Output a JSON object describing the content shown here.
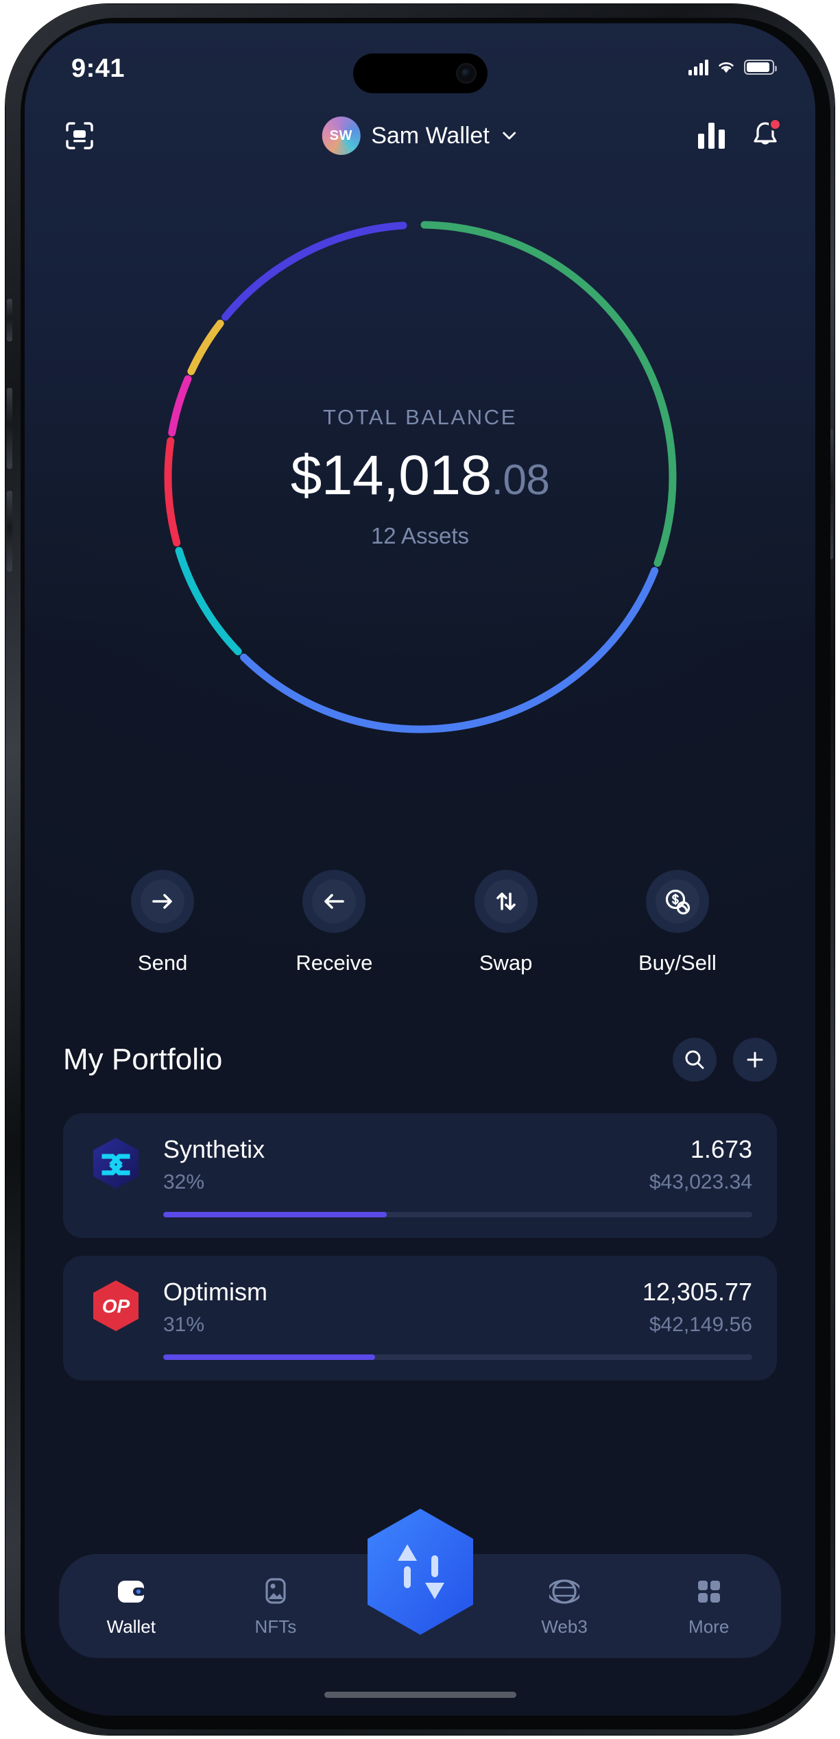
{
  "statusbar": {
    "time": "9:41",
    "signal_icon": "cellular-signal-icon",
    "wifi_icon": "wifi-icon",
    "battery_icon": "battery-icon"
  },
  "header": {
    "scan_icon": "scan-qr-icon",
    "avatar_initials": "SW",
    "wallet_name": "Sam Wallet",
    "chevron_icon": "chevron-down-icon",
    "chart_icon": "bar-chart-icon",
    "bell_icon": "bell-icon",
    "notification_badge": ""
  },
  "balance": {
    "label": "TOTAL BALANCE",
    "amount": "$14,018",
    "cents": ".08",
    "assets_count": "12 Assets"
  },
  "ring": {
    "segments": [
      {
        "name": "optimism",
        "color": "#3aa76d",
        "percent": 31
      },
      {
        "name": "synthetix",
        "color": "#4c7ef3",
        "percent": 32
      },
      {
        "name": "teal",
        "color": "#12bfcc",
        "percent": 8
      },
      {
        "name": "red",
        "color": "#ef2f4d",
        "percent": 7
      },
      {
        "name": "magenta",
        "color": "#e52bb0",
        "percent": 4
      },
      {
        "name": "yellow",
        "color": "#e8bb3f",
        "percent": 4
      },
      {
        "name": "indigo",
        "color": "#4b3fe0",
        "percent": 14
      }
    ]
  },
  "actions": [
    {
      "label": "Send",
      "icon": "arrow-right-icon"
    },
    {
      "label": "Receive",
      "icon": "arrow-left-icon"
    },
    {
      "label": "Swap",
      "icon": "swap-arrows-icon"
    },
    {
      "label": "Buy/Sell",
      "icon": "dollar-coins-icon"
    }
  ],
  "portfolio": {
    "title": "My Portfolio",
    "search_icon": "search-icon",
    "add_icon": "plus-icon",
    "assets": [
      {
        "name": "Synthetix",
        "percent": "32%",
        "quantity": "1.673",
        "value": "$43,023.34",
        "bar_percent": 38,
        "bar_color": "#5b49e8",
        "logo": "synthetix-logo"
      },
      {
        "name": "Optimism",
        "percent": "31%",
        "quantity": "12,305.77",
        "value": "$42,149.56",
        "bar_percent": 36,
        "bar_color": "#5b49e8",
        "logo": "optimism-logo"
      }
    ]
  },
  "tabbar": {
    "items": [
      {
        "label": "Wallet",
        "icon": "wallet-icon",
        "active": true
      },
      {
        "label": "NFTs",
        "icon": "nft-image-icon",
        "active": false
      },
      {
        "label": "Web3",
        "icon": "globe-icon",
        "active": false
      },
      {
        "label": "More",
        "icon": "grid-dots-icon",
        "active": false
      }
    ],
    "fab_icon": "hexagon-swap-fab-icon"
  },
  "colors": {
    "screen_bg": "#0f1524",
    "card_bg": "#18213a",
    "accent_blue": "#2f6bf0",
    "muted_text": "#6e7c9e"
  }
}
